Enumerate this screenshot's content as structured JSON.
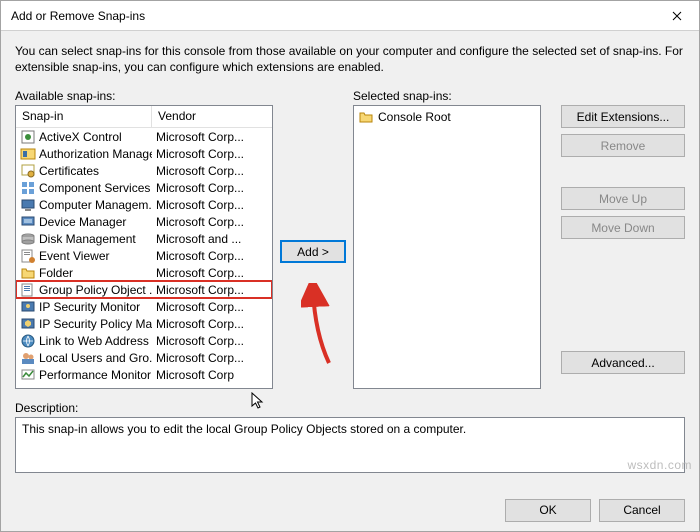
{
  "title": "Add or Remove Snap-ins",
  "intro": "You can select snap-ins for this console from those available on your computer and configure the selected set of snap-ins. For extensible snap-ins, you can configure which extensions are enabled.",
  "labels": {
    "available": "Available snap-ins:",
    "selected": "Selected snap-ins:",
    "description": "Description:"
  },
  "columns": {
    "snapin": "Snap-in",
    "vendor": "Vendor"
  },
  "available": [
    {
      "name": "ActiveX Control",
      "vendor": "Microsoft Corp...",
      "icon": "activex"
    },
    {
      "name": "Authorization Manager",
      "vendor": "Microsoft Corp...",
      "icon": "auth"
    },
    {
      "name": "Certificates",
      "vendor": "Microsoft Corp...",
      "icon": "cert"
    },
    {
      "name": "Component Services",
      "vendor": "Microsoft Corp...",
      "icon": "component"
    },
    {
      "name": "Computer Managem...",
      "vendor": "Microsoft Corp...",
      "icon": "computer"
    },
    {
      "name": "Device Manager",
      "vendor": "Microsoft Corp...",
      "icon": "device"
    },
    {
      "name": "Disk Management",
      "vendor": "Microsoft and ...",
      "icon": "disk"
    },
    {
      "name": "Event Viewer",
      "vendor": "Microsoft Corp...",
      "icon": "event"
    },
    {
      "name": "Folder",
      "vendor": "Microsoft Corp...",
      "icon": "folder"
    },
    {
      "name": "Group Policy Object ...",
      "vendor": "Microsoft Corp...",
      "icon": "gpo",
      "highlighted": true
    },
    {
      "name": "IP Security Monitor",
      "vendor": "Microsoft Corp...",
      "icon": "ipsecmon"
    },
    {
      "name": "IP Security Policy Ma...",
      "vendor": "Microsoft Corp...",
      "icon": "ipsecpol"
    },
    {
      "name": "Link to Web Address",
      "vendor": "Microsoft Corp...",
      "icon": "link"
    },
    {
      "name": "Local Users and Gro...",
      "vendor": "Microsoft Corp...",
      "icon": "users"
    },
    {
      "name": "Performance Monitor",
      "vendor": "Microsoft Corp",
      "icon": "perf"
    }
  ],
  "selected": [
    {
      "name": "Console Root",
      "icon": "folder"
    }
  ],
  "buttons": {
    "add": "Add >",
    "edit_ext": "Edit Extensions...",
    "remove": "Remove",
    "move_up": "Move Up",
    "move_down": "Move Down",
    "advanced": "Advanced...",
    "ok": "OK",
    "cancel": "Cancel"
  },
  "description_text": "This snap-in allows you to edit the local Group Policy Objects stored on a computer.",
  "watermark": "wsxdn.com"
}
